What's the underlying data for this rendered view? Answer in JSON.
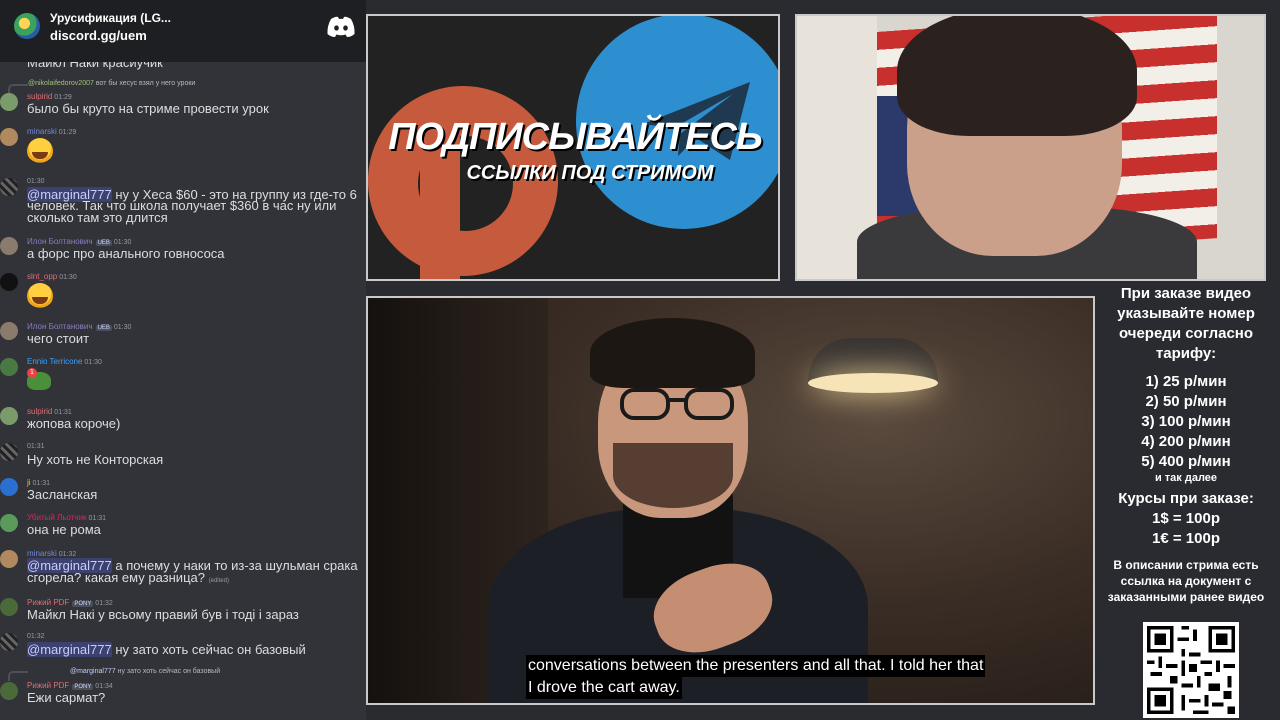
{
  "server": {
    "name": "Урусификация (LG...",
    "invite": "discord.gg/uem",
    "discord_icon": "discord-logo-icon"
  },
  "chat": {
    "cut_top": "Майкл Наки красиучик",
    "messages": [
      {
        "reply_user": "@nikolaifedorov2007",
        "reply_text": "вот бы хесус взял у него уроки",
        "user": "sulpirid",
        "user_color": "#e06c75",
        "time": "01:29",
        "text": "было бы круто на стриме провести урок"
      },
      {
        "user": "minarski",
        "user_color": "#7289da",
        "time": "01:29",
        "emoji": "joy-emoji"
      },
      {
        "user": "",
        "time": "01:30",
        "mention": "@marginal777",
        "text1": " ну у Хеса $60 - это на группу из где-то 6",
        "text2": "человек. Так что школа получает $360 в час ну или",
        "text3": "сколько там это длится"
      },
      {
        "user": "Илон Болтанович",
        "user_color": "#8e7cc3",
        "badge": "UEB",
        "time": "01:30",
        "text": "а  форс про анального говнососа"
      },
      {
        "user": "slnt_opp",
        "user_color": "#e06c75",
        "time": "01:30",
        "emoji": "joy-emoji"
      },
      {
        "user": "Илон Болтанович",
        "user_color": "#8e7cc3",
        "badge": "UEB",
        "time": "01:30",
        "text": "чего стоит"
      },
      {
        "user": "Ennio Terricone",
        "user_color": "#3ba0ff",
        "time": "01:30",
        "emoji": "pepe-emoji",
        "badge_count": "1"
      },
      {
        "user": "sulpirid",
        "user_color": "#e06c75",
        "time": "01:31",
        "text": "жопова короче)"
      },
      {
        "user": "",
        "time": "01:31",
        "text": "Ну хоть не Конторская"
      },
      {
        "user": "ji",
        "user_color": "#f1c40f",
        "time": "01:31",
        "text": "Засланская"
      },
      {
        "user": "Убитый Льотчик",
        "user_color": "#e91e63",
        "time": "01:31",
        "text": "она не рома"
      },
      {
        "user": "minarski",
        "user_color": "#7289da",
        "time": "01:32",
        "mention": "@marginal777",
        "text1": " а почему у наки то из-за шульман срака",
        "text2": "сгорела? какая ему разница?",
        "edited": "(edited)"
      },
      {
        "user": "Рижий PDF",
        "user_color": "#e06c75",
        "badge": "PONY",
        "time": "01:32",
        "text": "Майкл Накі у всьому правий був і тоді і зараз"
      },
      {
        "user": "",
        "time": "01:32",
        "mention": "@marginal777",
        "text": " ну зато хоть сейчас он базовый"
      },
      {
        "reply_user": "@marginal777",
        "reply_text": "ну зато хоть сейчас он базовый",
        "user": "Рижий PDF",
        "user_color": "#e06c75",
        "badge": "PONY",
        "time": "01:34",
        "text": "Ежи сармат?"
      }
    ]
  },
  "banner": {
    "headline": "ПОДПИСЫВАЙТЕСЬ",
    "subline": "ССЫЛКИ ПОД СТРИМОМ",
    "icons": [
      "patreon-logo-icon",
      "telegram-logo-icon"
    ]
  },
  "video": {
    "subtitle_line1": "conversations between the presenters and all that. I told her that",
    "subtitle_line2": "I drove the cart away."
  },
  "info": {
    "intro": "При заказе видео указывайте номер очереди согласно тарифу:",
    "tariffs": [
      "1) 25 р/мин",
      "2) 50 р/мин",
      "3) 100 р/мин",
      "4) 200 р/мин",
      "5) 400 р/мин"
    ],
    "tariffs_more": "и так далее",
    "rates_title": "Курсы при заказе:",
    "rates": [
      "1$ = 100р",
      "1€ = 100р"
    ],
    "description": "В описании стрима есть ссылка на документ с заказанными ранее видео"
  }
}
